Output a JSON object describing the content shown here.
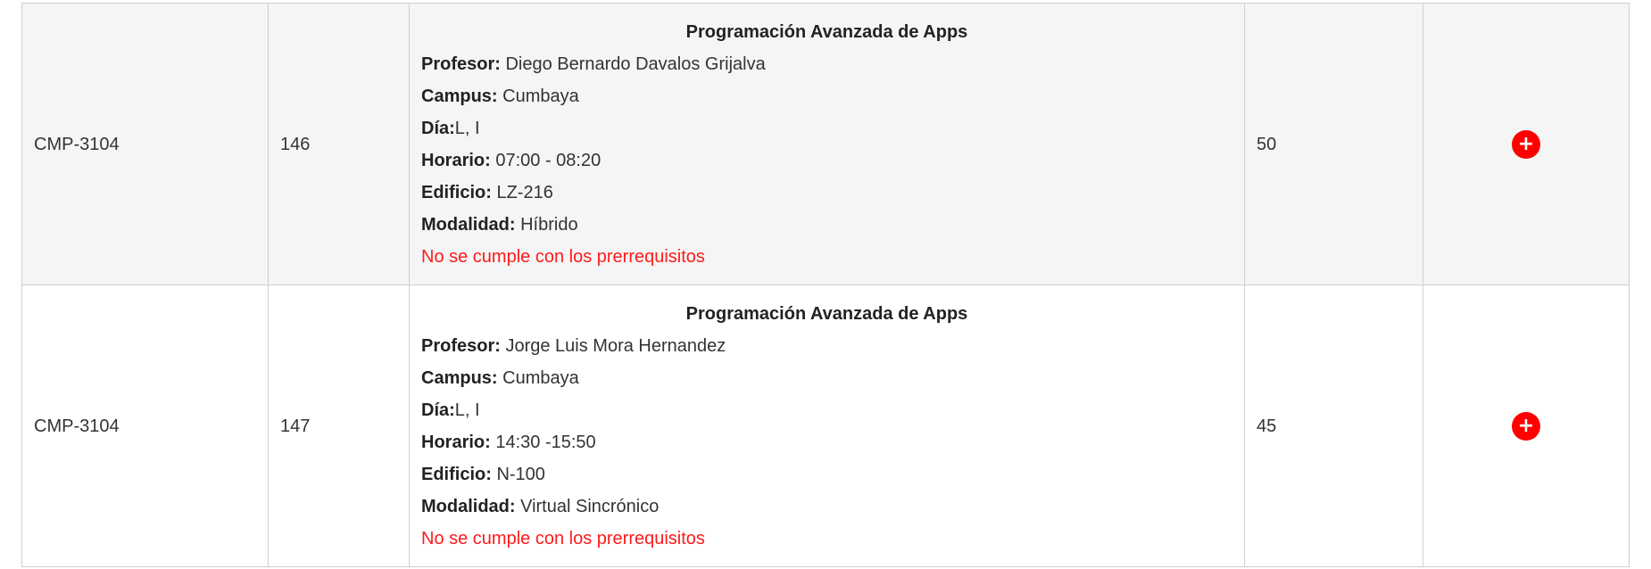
{
  "rows": [
    {
      "code": "CMP-3104",
      "nrc": "146",
      "title": "Programación Avanzada de Apps",
      "profesor_label": "Profesor:",
      "profesor": " Diego Bernardo Davalos Grijalva",
      "campus_label": "Campus:",
      "campus": " Cumbaya",
      "dia_label": "Día:",
      "dia": "L, I",
      "horario_label": "Horario:",
      "horario": " 07:00 - 08:20",
      "edificio_label": "Edificio:",
      "edificio": " LZ-216",
      "modalidad_label": "Modalidad:",
      "modalidad": " Híbrido",
      "warning": "No se cumple con los prerrequisitos",
      "capacity": "50",
      "add_icon": "+"
    },
    {
      "code": "CMP-3104",
      "nrc": "147",
      "title": "Programación Avanzada de Apps",
      "profesor_label": "Profesor:",
      "profesor": " Jorge Luis Mora Hernandez",
      "campus_label": "Campus:",
      "campus": " Cumbaya",
      "dia_label": "Día:",
      "dia": "L, I",
      "horario_label": "Horario:",
      "horario": " 14:30 -15:50",
      "edificio_label": "Edificio:",
      "edificio": " N-100",
      "modalidad_label": "Modalidad:",
      "modalidad": " Virtual Sincrónico",
      "warning": "No se cumple con los prerrequisitos",
      "capacity": "45",
      "add_icon": "+"
    }
  ],
  "colors": {
    "warning": "#ff1a1a",
    "add_button": "#ff0000",
    "odd_row_bg": "#f5f5f5",
    "border": "#cfcfcf"
  }
}
